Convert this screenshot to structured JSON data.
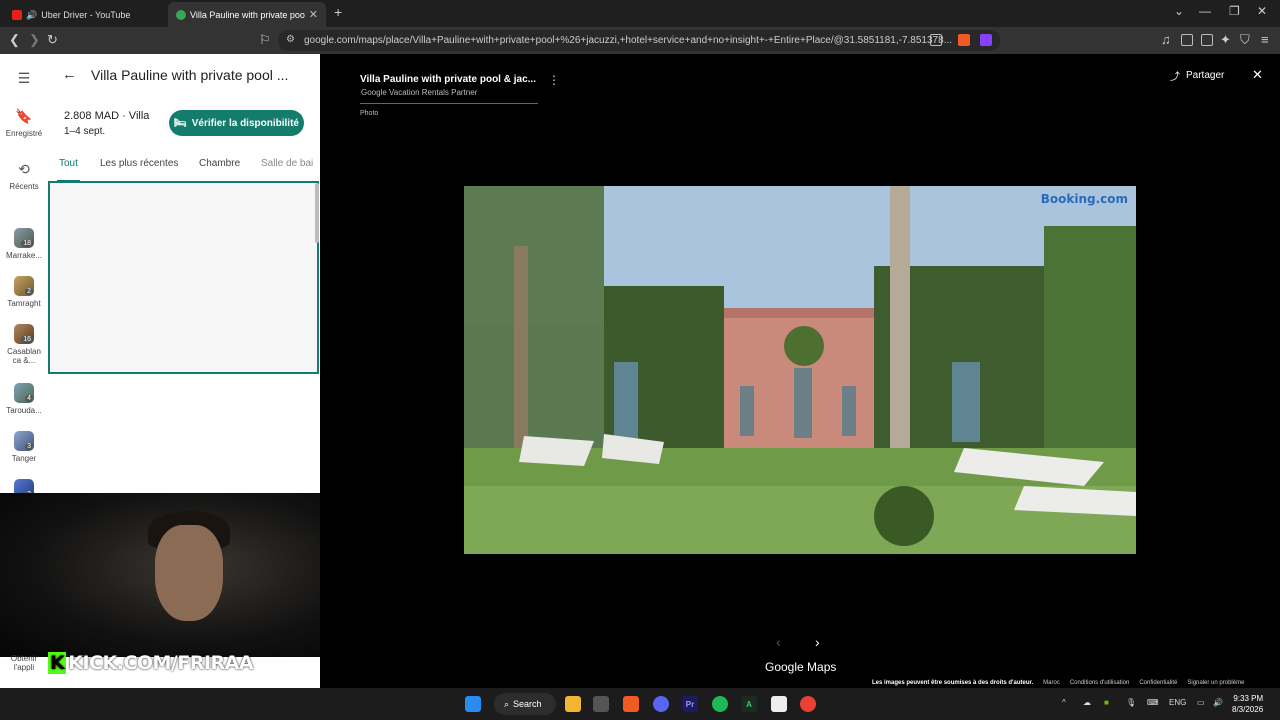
{
  "browser": {
    "tabs": [
      {
        "title": "Uber Driver - YouTube",
        "active": false
      },
      {
        "title": "Villa Pauline with private pool &",
        "active": true
      }
    ],
    "url": "google.com/maps/place/Villa+Pauline+with+private+pool+%26+jacuzzi,+hotel+service+and+no+insight+-+Entire+Place/@31.5851181,-7.851378..."
  },
  "rail": {
    "saved": "Enregistré",
    "recents": "Récents",
    "places": [
      {
        "label": "Marrake...",
        "count": "18"
      },
      {
        "label": "Tamraght",
        "count": "2"
      },
      {
        "label": "Casablan ca &...",
        "count": "16"
      },
      {
        "label": "Tarouda...",
        "count": "4"
      },
      {
        "label": "Tanger",
        "count": "3"
      },
      {
        "label": "",
        "count": "2"
      }
    ],
    "get_app": "Obtenir l'appli"
  },
  "panel": {
    "title": "Villa Pauline with private pool ...",
    "price": "2.808 MAD · Villa",
    "dates": "1–4 sept.",
    "availability_button": "Vérifier la disponibilité",
    "tabs": [
      "Tout",
      "Les plus récentes",
      "Chambre",
      "Salle de bai"
    ]
  },
  "overlay": {
    "kick": "KICK.COM/FRIRAA"
  },
  "viewer": {
    "title": "Villa Pauline with private pool & jac...",
    "subtitle": "Google Vacation Rentals Partner",
    "kind": "Photo",
    "share": "Partager",
    "watermark": "Booking.com",
    "brand": "Google Maps",
    "footer": {
      "copyright": "Les images peuvent être soumises à des droits d'auteur.",
      "country": "Maroc",
      "terms": "Conditions d'utilisation",
      "privacy": "Confidentialité",
      "report": "Signaler un problème"
    }
  },
  "taskbar": {
    "search": "Search",
    "lang": "ENG",
    "time": "9:33 PM",
    "date": "8/3/2026"
  }
}
